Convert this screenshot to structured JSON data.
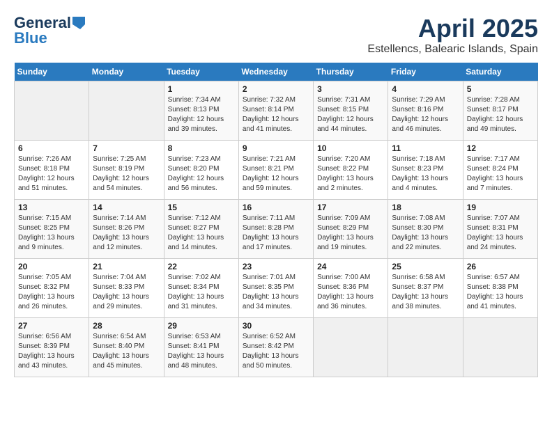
{
  "logo": {
    "text1": "General",
    "text2": "Blue"
  },
  "title": "April 2025",
  "location": "Estellencs, Balearic Islands, Spain",
  "days_header": [
    "Sunday",
    "Monday",
    "Tuesday",
    "Wednesday",
    "Thursday",
    "Friday",
    "Saturday"
  ],
  "weeks": [
    [
      {
        "day": "",
        "detail": ""
      },
      {
        "day": "",
        "detail": ""
      },
      {
        "day": "1",
        "detail": "Sunrise: 7:34 AM\nSunset: 8:13 PM\nDaylight: 12 hours and 39 minutes."
      },
      {
        "day": "2",
        "detail": "Sunrise: 7:32 AM\nSunset: 8:14 PM\nDaylight: 12 hours and 41 minutes."
      },
      {
        "day": "3",
        "detail": "Sunrise: 7:31 AM\nSunset: 8:15 PM\nDaylight: 12 hours and 44 minutes."
      },
      {
        "day": "4",
        "detail": "Sunrise: 7:29 AM\nSunset: 8:16 PM\nDaylight: 12 hours and 46 minutes."
      },
      {
        "day": "5",
        "detail": "Sunrise: 7:28 AM\nSunset: 8:17 PM\nDaylight: 12 hours and 49 minutes."
      }
    ],
    [
      {
        "day": "6",
        "detail": "Sunrise: 7:26 AM\nSunset: 8:18 PM\nDaylight: 12 hours and 51 minutes."
      },
      {
        "day": "7",
        "detail": "Sunrise: 7:25 AM\nSunset: 8:19 PM\nDaylight: 12 hours and 54 minutes."
      },
      {
        "day": "8",
        "detail": "Sunrise: 7:23 AM\nSunset: 8:20 PM\nDaylight: 12 hours and 56 minutes."
      },
      {
        "day": "9",
        "detail": "Sunrise: 7:21 AM\nSunset: 8:21 PM\nDaylight: 12 hours and 59 minutes."
      },
      {
        "day": "10",
        "detail": "Sunrise: 7:20 AM\nSunset: 8:22 PM\nDaylight: 13 hours and 2 minutes."
      },
      {
        "day": "11",
        "detail": "Sunrise: 7:18 AM\nSunset: 8:23 PM\nDaylight: 13 hours and 4 minutes."
      },
      {
        "day": "12",
        "detail": "Sunrise: 7:17 AM\nSunset: 8:24 PM\nDaylight: 13 hours and 7 minutes."
      }
    ],
    [
      {
        "day": "13",
        "detail": "Sunrise: 7:15 AM\nSunset: 8:25 PM\nDaylight: 13 hours and 9 minutes."
      },
      {
        "day": "14",
        "detail": "Sunrise: 7:14 AM\nSunset: 8:26 PM\nDaylight: 13 hours and 12 minutes."
      },
      {
        "day": "15",
        "detail": "Sunrise: 7:12 AM\nSunset: 8:27 PM\nDaylight: 13 hours and 14 minutes."
      },
      {
        "day": "16",
        "detail": "Sunrise: 7:11 AM\nSunset: 8:28 PM\nDaylight: 13 hours and 17 minutes."
      },
      {
        "day": "17",
        "detail": "Sunrise: 7:09 AM\nSunset: 8:29 PM\nDaylight: 13 hours and 19 minutes."
      },
      {
        "day": "18",
        "detail": "Sunrise: 7:08 AM\nSunset: 8:30 PM\nDaylight: 13 hours and 22 minutes."
      },
      {
        "day": "19",
        "detail": "Sunrise: 7:07 AM\nSunset: 8:31 PM\nDaylight: 13 hours and 24 minutes."
      }
    ],
    [
      {
        "day": "20",
        "detail": "Sunrise: 7:05 AM\nSunset: 8:32 PM\nDaylight: 13 hours and 26 minutes."
      },
      {
        "day": "21",
        "detail": "Sunrise: 7:04 AM\nSunset: 8:33 PM\nDaylight: 13 hours and 29 minutes."
      },
      {
        "day": "22",
        "detail": "Sunrise: 7:02 AM\nSunset: 8:34 PM\nDaylight: 13 hours and 31 minutes."
      },
      {
        "day": "23",
        "detail": "Sunrise: 7:01 AM\nSunset: 8:35 PM\nDaylight: 13 hours and 34 minutes."
      },
      {
        "day": "24",
        "detail": "Sunrise: 7:00 AM\nSunset: 8:36 PM\nDaylight: 13 hours and 36 minutes."
      },
      {
        "day": "25",
        "detail": "Sunrise: 6:58 AM\nSunset: 8:37 PM\nDaylight: 13 hours and 38 minutes."
      },
      {
        "day": "26",
        "detail": "Sunrise: 6:57 AM\nSunset: 8:38 PM\nDaylight: 13 hours and 41 minutes."
      }
    ],
    [
      {
        "day": "27",
        "detail": "Sunrise: 6:56 AM\nSunset: 8:39 PM\nDaylight: 13 hours and 43 minutes."
      },
      {
        "day": "28",
        "detail": "Sunrise: 6:54 AM\nSunset: 8:40 PM\nDaylight: 13 hours and 45 minutes."
      },
      {
        "day": "29",
        "detail": "Sunrise: 6:53 AM\nSunset: 8:41 PM\nDaylight: 13 hours and 48 minutes."
      },
      {
        "day": "30",
        "detail": "Sunrise: 6:52 AM\nSunset: 8:42 PM\nDaylight: 13 hours and 50 minutes."
      },
      {
        "day": "",
        "detail": ""
      },
      {
        "day": "",
        "detail": ""
      },
      {
        "day": "",
        "detail": ""
      }
    ]
  ]
}
